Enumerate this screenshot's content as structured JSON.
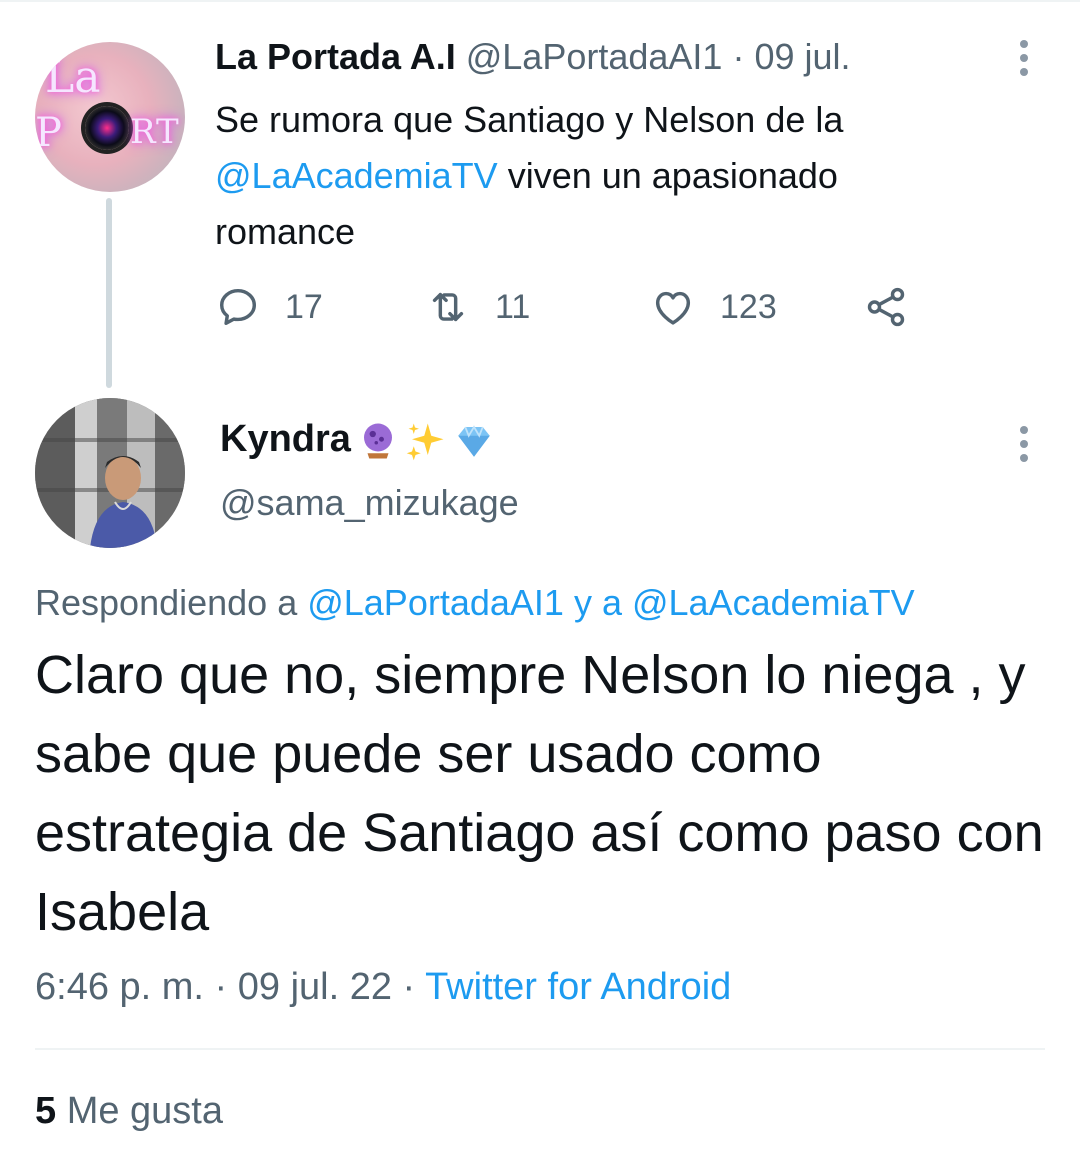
{
  "parent_tweet": {
    "author_name": "La Portada A.I",
    "author_handle": "@LaPortadaAI1",
    "separator": "·",
    "date": "09 jul.",
    "text_before": "Se rumora que Santiago y Nelson de la ",
    "mention": "@LaAcademiaTV",
    "text_after": " viven un apasionado romance",
    "avatar": {
      "line1": "La",
      "line2_left": "P",
      "line2_right": "RT"
    },
    "stats": {
      "replies": "17",
      "retweets": "11",
      "likes": "123"
    }
  },
  "reply_tweet": {
    "author_name": "Kyndra",
    "author_handle": "@sama_mizukage",
    "name_emojis": [
      "crystal-ball-icon",
      "sparkles-icon",
      "gem-icon"
    ],
    "replying_prefix": "Respondiendo a ",
    "replying_to_1": "@LaPortadaAI1",
    "replying_connector": " y a ",
    "replying_to_2": "@LaAcademiaTV",
    "text": "Claro que no, siempre Nelson lo niega , y sabe que puede ser usado como estrategia de Santiago así como paso con Isabela",
    "time": "6:46 p. m. · 09 jul. 22 · ",
    "source": "Twitter for Android",
    "likes_count": "5",
    "likes_label": " Me gusta"
  },
  "colors": {
    "accent": "#1d9bf0",
    "text": "#0f1419",
    "secondary": "#536471"
  }
}
